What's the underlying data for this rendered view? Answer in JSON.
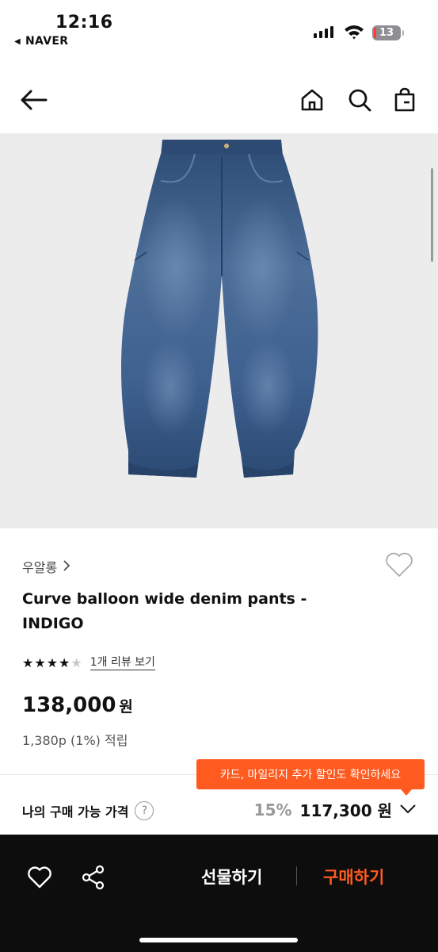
{
  "status_bar": {
    "time": "12:16",
    "back_app": "NAVER",
    "battery": "13"
  },
  "header": {
    "icons": [
      "back-arrow-icon",
      "home-icon",
      "search-icon",
      "shopping-bag-icon"
    ]
  },
  "product": {
    "brand": "우알롱",
    "title": "Curve balloon wide denim pants - INDIGO",
    "rating": 4,
    "review_link": "1개 리뷰 보기",
    "price": "138,000",
    "currency": "원",
    "points": "1,380p (1%) 적립"
  },
  "tooltip": "카드, 마일리지 추가 할인도 확인하세요",
  "buy_row": {
    "label": "나의 구매 가능 가격",
    "help": "?",
    "discount": "15%",
    "final_price": "117,300",
    "currency": "원"
  },
  "bottom_bar": {
    "gift_label": "선물하기",
    "buy_label": "구매하기"
  },
  "colors": {
    "accent": "#ff5a1f",
    "bottom_bg": "#0d0d0d",
    "image_bg": "#ececec"
  }
}
